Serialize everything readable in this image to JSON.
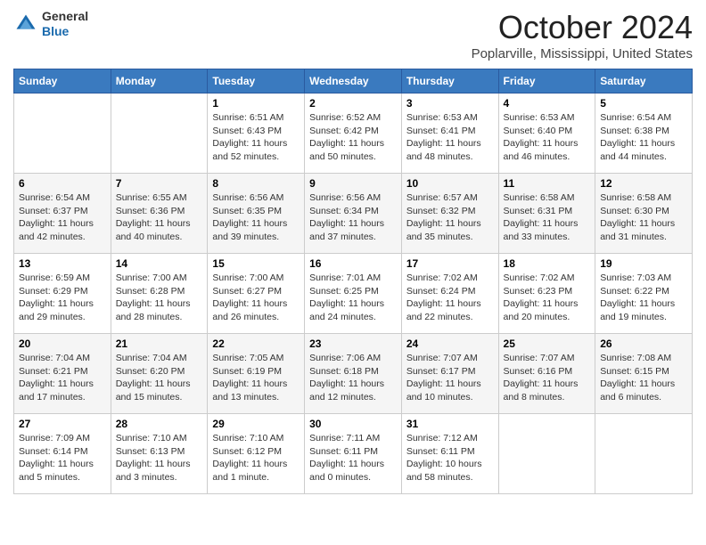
{
  "header": {
    "logo_general": "General",
    "logo_blue": "Blue",
    "month_title": "October 2024",
    "location": "Poplarville, Mississippi, United States"
  },
  "days_of_week": [
    "Sunday",
    "Monday",
    "Tuesday",
    "Wednesday",
    "Thursday",
    "Friday",
    "Saturday"
  ],
  "weeks": [
    [
      {
        "day": "",
        "info": ""
      },
      {
        "day": "",
        "info": ""
      },
      {
        "day": "1",
        "info": "Sunrise: 6:51 AM\nSunset: 6:43 PM\nDaylight: 11 hours and 52 minutes."
      },
      {
        "day": "2",
        "info": "Sunrise: 6:52 AM\nSunset: 6:42 PM\nDaylight: 11 hours and 50 minutes."
      },
      {
        "day": "3",
        "info": "Sunrise: 6:53 AM\nSunset: 6:41 PM\nDaylight: 11 hours and 48 minutes."
      },
      {
        "day": "4",
        "info": "Sunrise: 6:53 AM\nSunset: 6:40 PM\nDaylight: 11 hours and 46 minutes."
      },
      {
        "day": "5",
        "info": "Sunrise: 6:54 AM\nSunset: 6:38 PM\nDaylight: 11 hours and 44 minutes."
      }
    ],
    [
      {
        "day": "6",
        "info": "Sunrise: 6:54 AM\nSunset: 6:37 PM\nDaylight: 11 hours and 42 minutes."
      },
      {
        "day": "7",
        "info": "Sunrise: 6:55 AM\nSunset: 6:36 PM\nDaylight: 11 hours and 40 minutes."
      },
      {
        "day": "8",
        "info": "Sunrise: 6:56 AM\nSunset: 6:35 PM\nDaylight: 11 hours and 39 minutes."
      },
      {
        "day": "9",
        "info": "Sunrise: 6:56 AM\nSunset: 6:34 PM\nDaylight: 11 hours and 37 minutes."
      },
      {
        "day": "10",
        "info": "Sunrise: 6:57 AM\nSunset: 6:32 PM\nDaylight: 11 hours and 35 minutes."
      },
      {
        "day": "11",
        "info": "Sunrise: 6:58 AM\nSunset: 6:31 PM\nDaylight: 11 hours and 33 minutes."
      },
      {
        "day": "12",
        "info": "Sunrise: 6:58 AM\nSunset: 6:30 PM\nDaylight: 11 hours and 31 minutes."
      }
    ],
    [
      {
        "day": "13",
        "info": "Sunrise: 6:59 AM\nSunset: 6:29 PM\nDaylight: 11 hours and 29 minutes."
      },
      {
        "day": "14",
        "info": "Sunrise: 7:00 AM\nSunset: 6:28 PM\nDaylight: 11 hours and 28 minutes."
      },
      {
        "day": "15",
        "info": "Sunrise: 7:00 AM\nSunset: 6:27 PM\nDaylight: 11 hours and 26 minutes."
      },
      {
        "day": "16",
        "info": "Sunrise: 7:01 AM\nSunset: 6:25 PM\nDaylight: 11 hours and 24 minutes."
      },
      {
        "day": "17",
        "info": "Sunrise: 7:02 AM\nSunset: 6:24 PM\nDaylight: 11 hours and 22 minutes."
      },
      {
        "day": "18",
        "info": "Sunrise: 7:02 AM\nSunset: 6:23 PM\nDaylight: 11 hours and 20 minutes."
      },
      {
        "day": "19",
        "info": "Sunrise: 7:03 AM\nSunset: 6:22 PM\nDaylight: 11 hours and 19 minutes."
      }
    ],
    [
      {
        "day": "20",
        "info": "Sunrise: 7:04 AM\nSunset: 6:21 PM\nDaylight: 11 hours and 17 minutes."
      },
      {
        "day": "21",
        "info": "Sunrise: 7:04 AM\nSunset: 6:20 PM\nDaylight: 11 hours and 15 minutes."
      },
      {
        "day": "22",
        "info": "Sunrise: 7:05 AM\nSunset: 6:19 PM\nDaylight: 11 hours and 13 minutes."
      },
      {
        "day": "23",
        "info": "Sunrise: 7:06 AM\nSunset: 6:18 PM\nDaylight: 11 hours and 12 minutes."
      },
      {
        "day": "24",
        "info": "Sunrise: 7:07 AM\nSunset: 6:17 PM\nDaylight: 11 hours and 10 minutes."
      },
      {
        "day": "25",
        "info": "Sunrise: 7:07 AM\nSunset: 6:16 PM\nDaylight: 11 hours and 8 minutes."
      },
      {
        "day": "26",
        "info": "Sunrise: 7:08 AM\nSunset: 6:15 PM\nDaylight: 11 hours and 6 minutes."
      }
    ],
    [
      {
        "day": "27",
        "info": "Sunrise: 7:09 AM\nSunset: 6:14 PM\nDaylight: 11 hours and 5 minutes."
      },
      {
        "day": "28",
        "info": "Sunrise: 7:10 AM\nSunset: 6:13 PM\nDaylight: 11 hours and 3 minutes."
      },
      {
        "day": "29",
        "info": "Sunrise: 7:10 AM\nSunset: 6:12 PM\nDaylight: 11 hours and 1 minute."
      },
      {
        "day": "30",
        "info": "Sunrise: 7:11 AM\nSunset: 6:11 PM\nDaylight: 11 hours and 0 minutes."
      },
      {
        "day": "31",
        "info": "Sunrise: 7:12 AM\nSunset: 6:11 PM\nDaylight: 10 hours and 58 minutes."
      },
      {
        "day": "",
        "info": ""
      },
      {
        "day": "",
        "info": ""
      }
    ]
  ]
}
